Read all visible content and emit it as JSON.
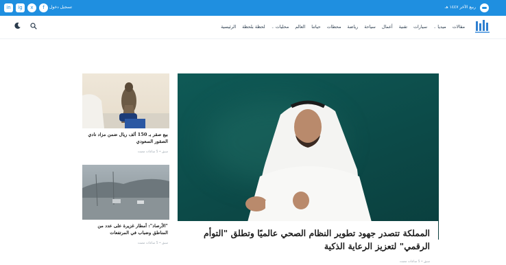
{
  "topbar": {
    "date": "ربيع الآخر ١٤٤٧ هـ",
    "login": "تسجيل دخول",
    "social": [
      "in",
      "ig",
      "x",
      "f"
    ]
  },
  "nav": {
    "items": [
      {
        "label": "الرئيسية"
      },
      {
        "label": "لحظة بلحظة"
      },
      {
        "label": "محليات",
        "dropdown": true
      },
      {
        "label": "العالم"
      },
      {
        "label": "حياتنا"
      },
      {
        "label": "محطات"
      },
      {
        "label": "رياضة"
      },
      {
        "label": "سياحة"
      },
      {
        "label": "أعمال"
      },
      {
        "label": "تقنية"
      },
      {
        "label": "سيارات"
      },
      {
        "label": "ميديا",
        "dropdown": true
      },
      {
        "label": "مقالات"
      }
    ],
    "chevron": "⌄"
  },
  "hero": {
    "title": "المملكة تتصدر جهود تطوير النظام الصحي عالميًا وتطلق \"التوأم الرقمي\" لتعزيز الرعاية الذكية",
    "meta": "سبق • 5 ساعات مضت"
  },
  "cards": [
    {
      "title": "بيع صقر بـ 150 ألف ريال ضمن مزاد نادي الصقور السعودي",
      "meta": "سبق • 5 ساعات مضت"
    },
    {
      "title": "\"الأرصاد\": أمطار غزيرة على عدد من المناطق وضباب في المرتفعات",
      "meta": "سبق • 5 ساعات مضت"
    }
  ],
  "colors": {
    "topbar": "#1f8fe0",
    "hero_bg": "#0c4a48"
  }
}
